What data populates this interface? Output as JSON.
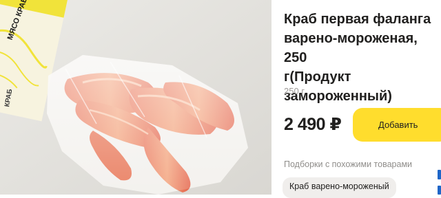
{
  "product": {
    "title": "Краб первая фаланга\nварено-мороженая, 250\nг(Продукт\nзамороженный)",
    "weight": "250 г",
    "price": "2 490 ₽",
    "package_text": {
      "brand_lines": [
        "МЯСО КРАБА"
      ],
      "side_label": "КРАБ"
    }
  },
  "actions": {
    "add_label": "Добавить"
  },
  "similar": {
    "heading": "Подборки с похожими товарами",
    "chips": [
      "Краб варено-мороженый"
    ]
  },
  "colors": {
    "accent": "#ffdd2d",
    "chip_bg": "#f0eeec",
    "muted_text": "#9e9b98",
    "photo_bg": "#e6e4e0"
  },
  "icons": [
    "product-photo"
  ]
}
